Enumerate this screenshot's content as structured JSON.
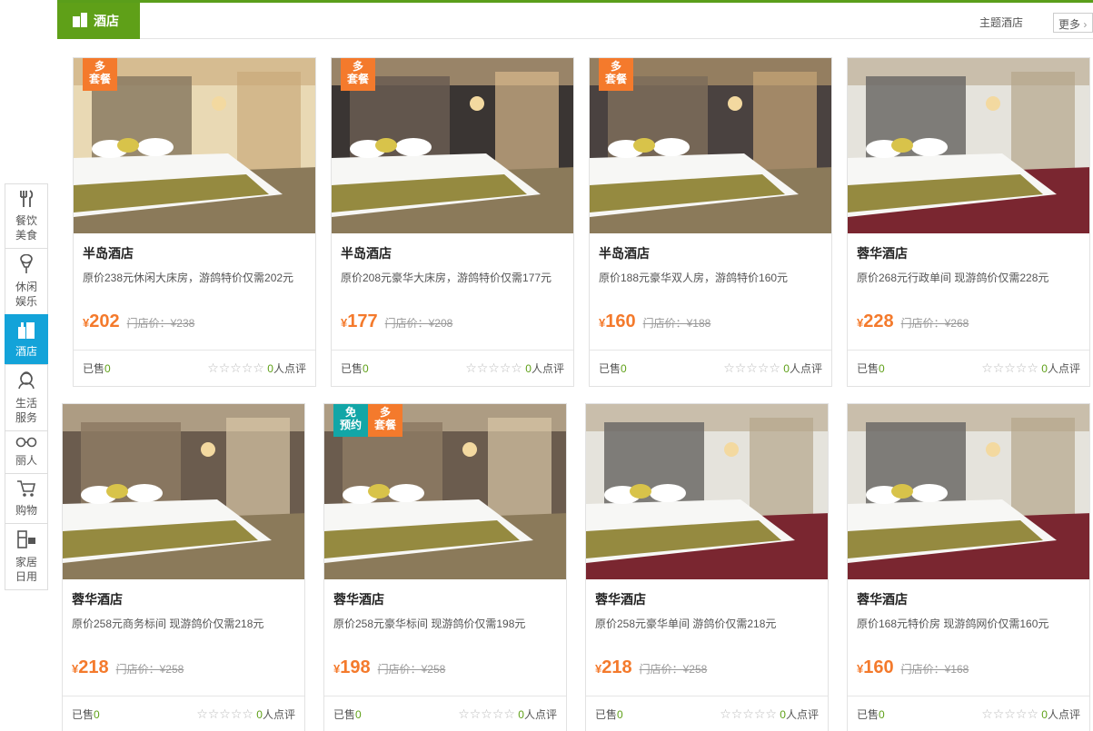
{
  "header": {
    "tab_label": "酒店",
    "theme_link": "主题酒店",
    "more_label": "更多"
  },
  "sidenav": [
    {
      "label": "餐饮美食",
      "icon": "utensils-icon"
    },
    {
      "label": "休闲娱乐",
      "icon": "microphone-icon"
    },
    {
      "label": "酒店",
      "icon": "hotel-building-icon",
      "active": true
    },
    {
      "label": "生活服务",
      "icon": "service-icon"
    },
    {
      "label": "丽人",
      "icon": "glasses-icon"
    },
    {
      "label": "购物",
      "icon": "cart-icon"
    },
    {
      "label": "家居日用",
      "icon": "appliance-icon"
    }
  ],
  "cards": [
    {
      "name": "半岛酒店",
      "desc": "原价238元休闲大床房，游鸽特价仅需202元",
      "currency": "¥",
      "price": "202",
      "orig": "门店价：¥238",
      "sold_label": "已售",
      "sold": "0",
      "rating_count": "0",
      "rating_suffix": "人点评",
      "badges": [
        "多\n套餐"
      ],
      "badge_colors": [
        "orange"
      ]
    },
    {
      "name": "半岛酒店",
      "desc": "原价208元豪华大床房，游鸽特价仅需177元",
      "currency": "¥",
      "price": "177",
      "orig": "门店价：¥208",
      "sold_label": "已售",
      "sold": "0",
      "rating_count": "0",
      "rating_suffix": "人点评",
      "badges": [
        "多\n套餐"
      ],
      "badge_colors": [
        "orange"
      ]
    },
    {
      "name": "半岛酒店",
      "desc": "原价188元豪华双人房，游鸽特价160元",
      "currency": "¥",
      "price": "160",
      "orig": "门店价：¥188",
      "sold_label": "已售",
      "sold": "0",
      "rating_count": "0",
      "rating_suffix": "人点评",
      "badges": [
        "多\n套餐"
      ],
      "badge_colors": [
        "orange"
      ]
    },
    {
      "name": "蓉华酒店",
      "desc": "原价268元行政单间 现游鸽价仅需228元",
      "currency": "¥",
      "price": "228",
      "orig": "门店价：¥268",
      "sold_label": "已售",
      "sold": "0",
      "rating_count": "0",
      "rating_suffix": "人点评",
      "badges": [],
      "badge_colors": []
    },
    {
      "name": "蓉华酒店",
      "desc": "原价258元商务标间 现游鸽价仅需218元",
      "currency": "¥",
      "price": "218",
      "orig": "门店价：¥258",
      "sold_label": "已售",
      "sold": "0",
      "rating_count": "0",
      "rating_suffix": "人点评",
      "badges": [],
      "badge_colors": []
    },
    {
      "name": "蓉华酒店",
      "desc": "原价258元豪华标间 现游鸽价仅需198元",
      "currency": "¥",
      "price": "198",
      "orig": "门店价：¥258",
      "sold_label": "已售",
      "sold": "0",
      "rating_count": "0",
      "rating_suffix": "人点评",
      "badges": [
        "免\n预约",
        "多\n套餐"
      ],
      "badge_colors": [
        "teal",
        "orange"
      ]
    },
    {
      "name": "蓉华酒店",
      "desc": "原价258元豪华单间 游鸽价仅需218元",
      "currency": "¥",
      "price": "218",
      "orig": "门店价：¥258",
      "sold_label": "已售",
      "sold": "0",
      "rating_count": "0",
      "rating_suffix": "人点评",
      "badges": [],
      "badge_colors": []
    },
    {
      "name": "蓉华酒店",
      "desc": "原价168元特价房 现游鸽网价仅需160元",
      "currency": "¥",
      "price": "160",
      "orig": "门店价：¥168",
      "sold_label": "已售",
      "sold": "0",
      "rating_count": "0",
      "rating_suffix": "人点评",
      "badges": [],
      "badge_colors": []
    }
  ],
  "colors": {
    "accent_green": "#5fa018",
    "nav_active": "#13a3d9",
    "price_orange": "#f47a2c",
    "badge_teal": "#12a6a7"
  }
}
